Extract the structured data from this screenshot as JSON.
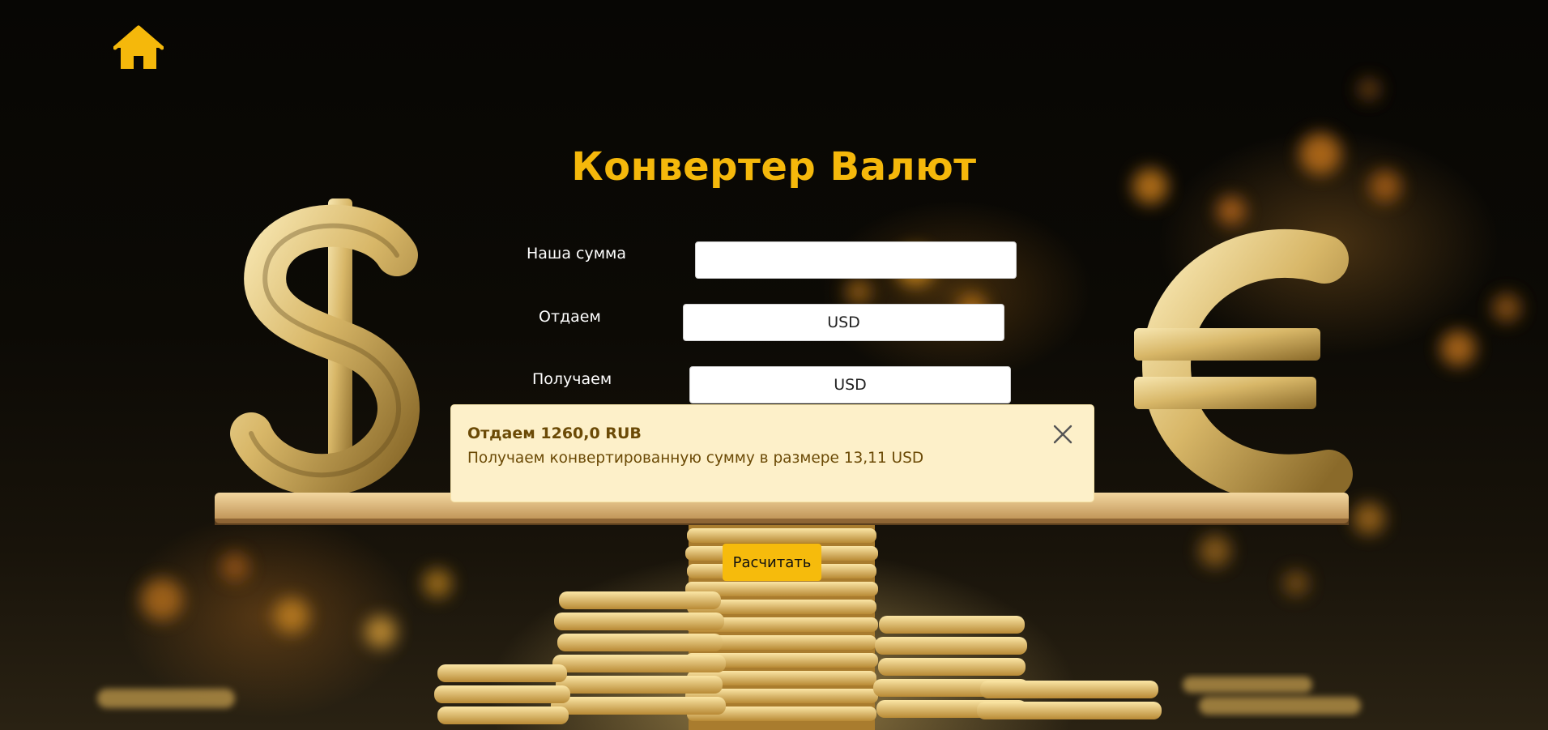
{
  "header": {
    "home_icon": "home-icon"
  },
  "converter": {
    "title": "Конвертер Валют",
    "amount_label": "Наша сумма",
    "amount_value": "",
    "give_label": "Отдаем",
    "give_currency": "USD",
    "receive_label": "Получаем",
    "receive_currency": "USD",
    "calculate_label": "Расчитать"
  },
  "result_alert": {
    "give_prefix": "Отдаем",
    "give_amount": "1260,0 RUB",
    "message": "Получаем конвертированную сумму в размере 13,11 USD",
    "close_icon": "close-icon"
  },
  "colors": {
    "accent": "#f5b80b",
    "alert_background": "#fdf0c9",
    "alert_text": "#6b4a06",
    "background": "#0a0805"
  }
}
